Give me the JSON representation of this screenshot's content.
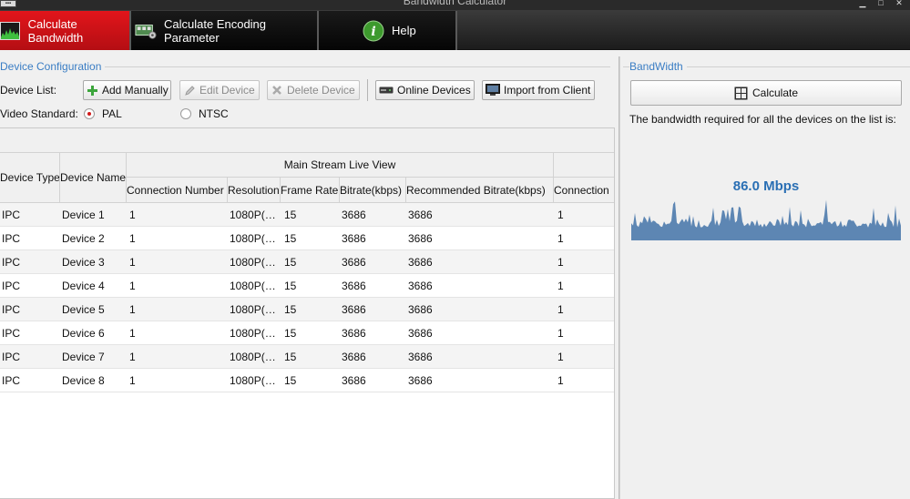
{
  "window": {
    "title": "Bandwidth Calculator"
  },
  "tabs": [
    {
      "label": "Calculate Bandwidth",
      "icon": "bandwidth-chart-icon",
      "active": true
    },
    {
      "label": "Calculate Encoding Parameter",
      "icon": "encoding-board-icon",
      "active": false
    },
    {
      "label": "Help",
      "icon": "info-icon",
      "active": false
    }
  ],
  "device_config": {
    "group_label": "Device Configuration",
    "device_list_label": "Device List:",
    "buttons": {
      "add_manually": "Add Manually",
      "edit_device": "Edit Device",
      "delete_device": "Delete Device",
      "online_devices": "Online Devices",
      "import_from_client": "Import from Client"
    },
    "video_standard_label": "Video Standard:",
    "video_standard_options": [
      "PAL",
      "NTSC"
    ],
    "video_standard_selected": "PAL"
  },
  "table": {
    "group_header": "Main Stream Live View",
    "columns": {
      "device_type": "Device Type",
      "device_name": "Device Name",
      "connection_number": "Connection Number",
      "resolution": "Resolution",
      "frame_rate": "Frame Rate",
      "bitrate": "Bitrate(kbps)",
      "recommended_bitrate": "Recommended Bitrate(kbps)",
      "connection": "Connection"
    },
    "rows": [
      {
        "device_type": "IPC",
        "device_name": "Device 1",
        "connection_number": "1",
        "resolution": "1080P(…",
        "frame_rate": "15",
        "bitrate": "3686",
        "recommended_bitrate": "3686",
        "connection": "1"
      },
      {
        "device_type": "IPC",
        "device_name": "Device 2",
        "connection_number": "1",
        "resolution": "1080P(…",
        "frame_rate": "15",
        "bitrate": "3686",
        "recommended_bitrate": "3686",
        "connection": "1"
      },
      {
        "device_type": "IPC",
        "device_name": "Device 3",
        "connection_number": "1",
        "resolution": "1080P(…",
        "frame_rate": "15",
        "bitrate": "3686",
        "recommended_bitrate": "3686",
        "connection": "1"
      },
      {
        "device_type": "IPC",
        "device_name": "Device 4",
        "connection_number": "1",
        "resolution": "1080P(…",
        "frame_rate": "15",
        "bitrate": "3686",
        "recommended_bitrate": "3686",
        "connection": "1"
      },
      {
        "device_type": "IPC",
        "device_name": "Device 5",
        "connection_number": "1",
        "resolution": "1080P(…",
        "frame_rate": "15",
        "bitrate": "3686",
        "recommended_bitrate": "3686",
        "connection": "1"
      },
      {
        "device_type": "IPC",
        "device_name": "Device 6",
        "connection_number": "1",
        "resolution": "1080P(…",
        "frame_rate": "15",
        "bitrate": "3686",
        "recommended_bitrate": "3686",
        "connection": "1"
      },
      {
        "device_type": "IPC",
        "device_name": "Device 7",
        "connection_number": "1",
        "resolution": "1080P(…",
        "frame_rate": "15",
        "bitrate": "3686",
        "recommended_bitrate": "3686",
        "connection": "1"
      },
      {
        "device_type": "IPC",
        "device_name": "Device 8",
        "connection_number": "1",
        "resolution": "1080P(…",
        "frame_rate": "15",
        "bitrate": "3686",
        "recommended_bitrate": "3686",
        "connection": "1"
      }
    ]
  },
  "bandwidth": {
    "group_label": "BandWidth",
    "calculate_label": "Calculate",
    "description": "The bandwidth required for all the devices on the list is:",
    "value": "86.0 Mbps"
  },
  "colors": {
    "accent_red": "#d0141a",
    "group_label_blue": "#3a7dc4",
    "bandwidth_value_blue": "#2a6fb4",
    "bandwidth_wave": "#5d86b3"
  }
}
